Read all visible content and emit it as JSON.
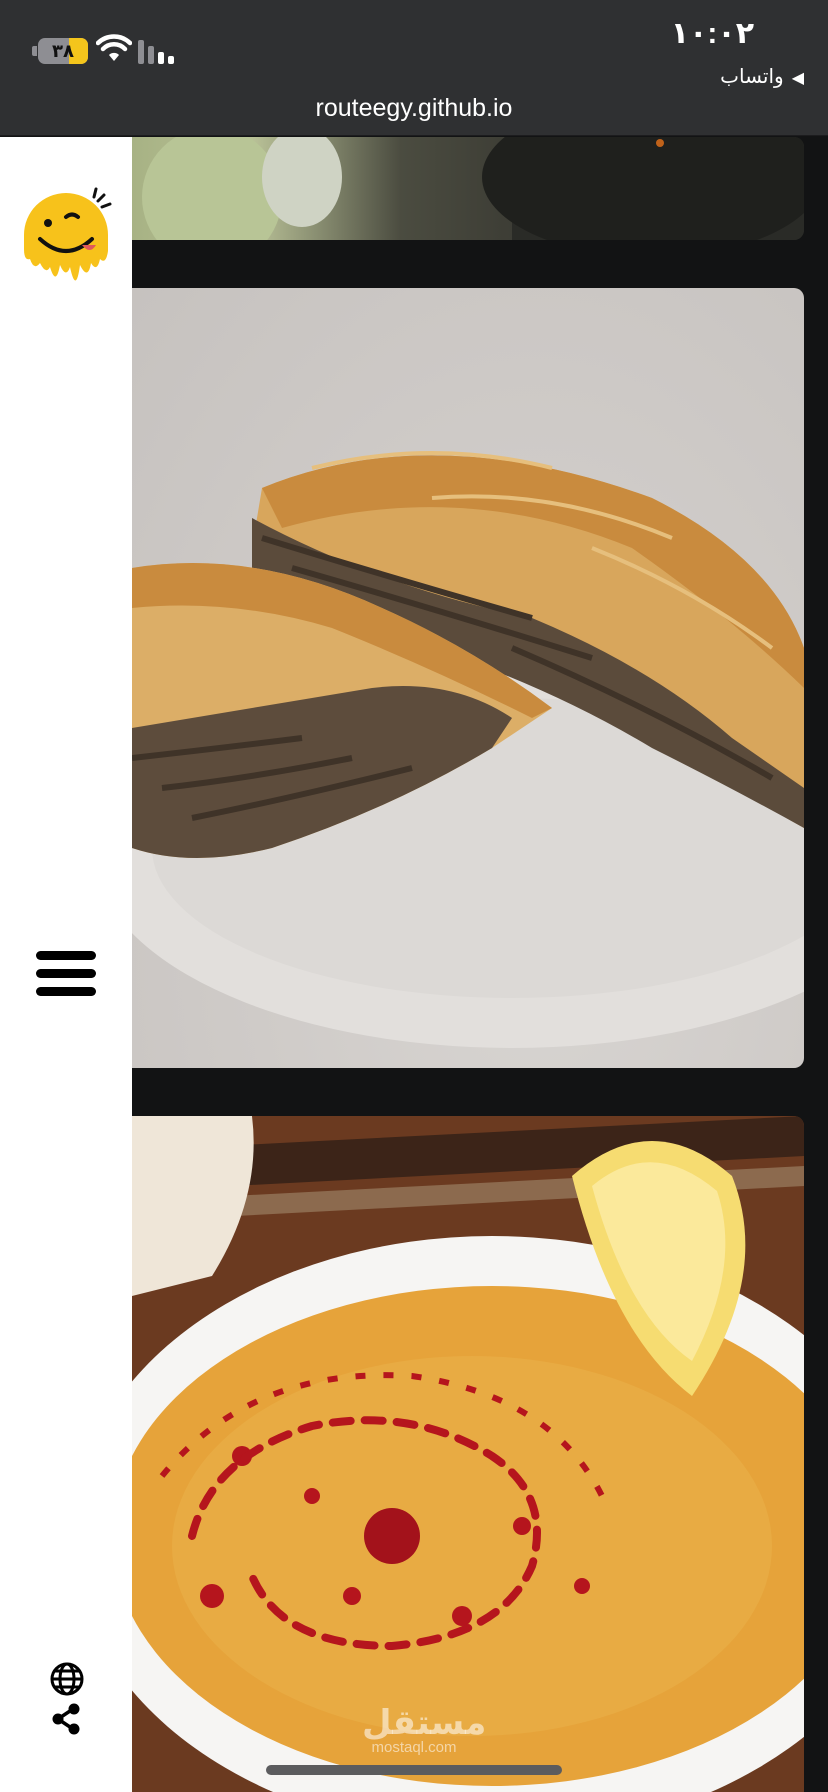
{
  "status_bar": {
    "time": "١٠:٠٢",
    "back_app": "واتساب",
    "battery_level": "٣٨",
    "battery_fraction": 0.38,
    "battery_color": "#f4c51c",
    "icons": [
      "wifi-icon",
      "cellular-signal-icon",
      "battery-icon"
    ]
  },
  "browser": {
    "url": "routeegy.github.io"
  },
  "sidebar": {
    "logo": "smiley-face-logo",
    "menu": "hamburger-menu-icon",
    "language": "globe-icon",
    "share": "share-icon",
    "accent_color": "#f7c21b"
  },
  "gallery": {
    "images": [
      "vegetable-dish-photo",
      "meat-borek-pastry-photo",
      "lentil-soup-photo"
    ]
  },
  "watermark": {
    "arabic": "مستقل",
    "latin": "mostaql.com"
  }
}
